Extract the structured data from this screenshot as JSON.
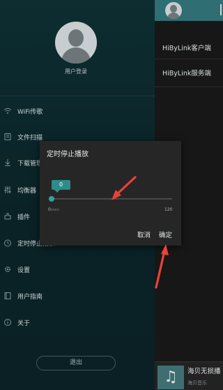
{
  "drawer": {
    "login_label": "用户登录",
    "items": [
      {
        "icon": "wifi-icon",
        "label": "WiFi传歌"
      },
      {
        "icon": "scan-icon",
        "label": "文件扫描"
      },
      {
        "icon": "download-icon",
        "label": "下载管理"
      },
      {
        "icon": "equalizer-icon",
        "label": "均衡器"
      },
      {
        "icon": "plugin-icon",
        "label": "插件"
      },
      {
        "icon": "timer-icon",
        "label": "定时停止播放"
      },
      {
        "icon": "settings-icon",
        "label": "设置"
      },
      {
        "icon": "guide-icon",
        "label": "用户指南"
      },
      {
        "icon": "info-icon",
        "label": "关于"
      }
    ],
    "logout_label": "退出"
  },
  "right_panel": {
    "rows": [
      "HiByLink客户端",
      "HiByLink服务端"
    ],
    "player": {
      "title": "海贝无损播",
      "subtitle": "海贝音乐"
    }
  },
  "dialog": {
    "title": "定时停止播放",
    "value": "0",
    "min_label": "0",
    "min_unit": "(min)",
    "max_label": "120",
    "slider_fraction": 0,
    "cancel_label": "取消",
    "ok_label": "确定"
  },
  "colors": {
    "accent": "#2fa39f",
    "annotation": "#e8423a"
  }
}
